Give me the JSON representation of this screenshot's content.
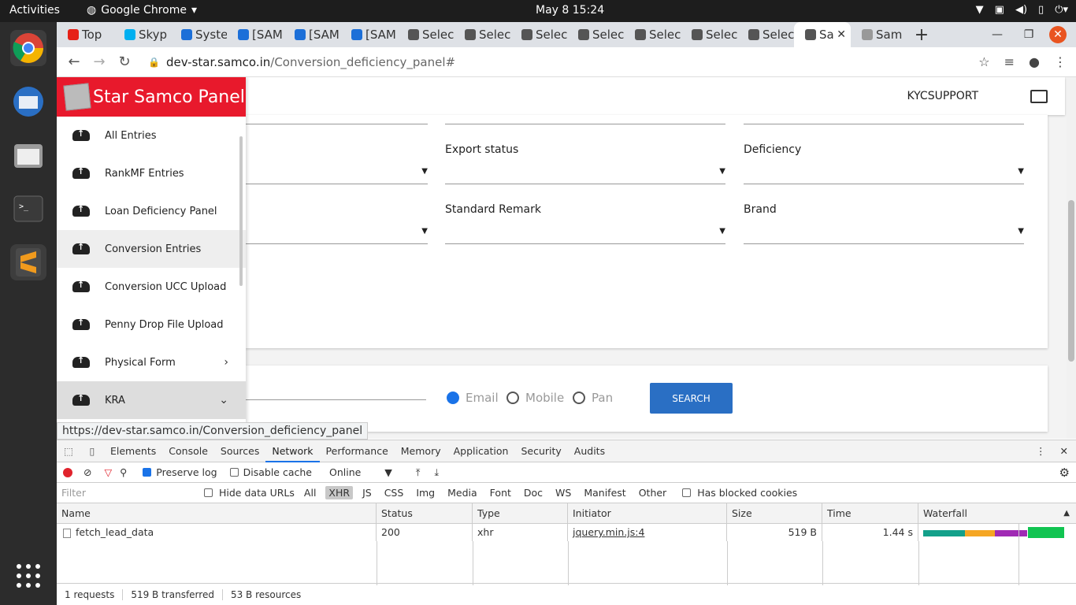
{
  "topbar": {
    "activities": "Activities",
    "app": "Google Chrome",
    "clock": "May 8  15:24"
  },
  "tabs": [
    {
      "label": "Top",
      "color": "#e62117"
    },
    {
      "label": "Skyp",
      "color": "#00aff0"
    },
    {
      "label": "Syste",
      "color": "#1c6fd8"
    },
    {
      "label": "[SAM",
      "color": "#1c6fd8"
    },
    {
      "label": "[SAM",
      "color": "#1c6fd8"
    },
    {
      "label": "[SAM",
      "color": "#1c6fd8"
    },
    {
      "label": "Selec",
      "color": "#555"
    },
    {
      "label": "Selec",
      "color": "#555"
    },
    {
      "label": "Selec",
      "color": "#555"
    },
    {
      "label": "Selec",
      "color": "#555"
    },
    {
      "label": "Selec",
      "color": "#555"
    },
    {
      "label": "Selec",
      "color": "#555"
    },
    {
      "label": "Selec",
      "color": "#555"
    },
    {
      "label": "Sa",
      "color": "#555"
    },
    {
      "label": "Sam",
      "color": "#999"
    }
  ],
  "omnibar": {
    "host": "dev-star.samco.in",
    "path": "/Conversion_deficiency_panel#"
  },
  "header": {
    "user": "KYCSUPPORT"
  },
  "brand": {
    "title": "Star Samco Panel"
  },
  "nav": [
    {
      "label": "All Entries"
    },
    {
      "label": "RankMF Entries"
    },
    {
      "label": "Loan Deficiency Panel"
    },
    {
      "label": "Conversion Entries"
    },
    {
      "label": "Conversion UCC Upload"
    },
    {
      "label": "Penny Drop File Upload"
    },
    {
      "label": "Physical Form",
      "chev": "›"
    },
    {
      "label": "KRA",
      "chev": "⌄"
    }
  ],
  "filters": {
    "export_status": "Export status",
    "deficiency": "Deficiency",
    "standard_remark": "Standard Remark",
    "brand": "Brand"
  },
  "search": {
    "opt_email": "Email",
    "opt_mobile": "Mobile",
    "opt_pan": "Pan",
    "button": "SEARCH"
  },
  "status_url": "https://dev-star.samco.in/Conversion_deficiency_panel",
  "devtools": {
    "tabs": [
      "Elements",
      "Console",
      "Sources",
      "Network",
      "Performance",
      "Memory",
      "Application",
      "Security",
      "Audits"
    ],
    "preserve_log": "Preserve log",
    "disable_cache": "Disable cache",
    "throttle": "Online",
    "filter_placeholder": "Filter",
    "hide_data_urls": "Hide data URLs",
    "types": [
      "All",
      "XHR",
      "JS",
      "CSS",
      "Img",
      "Media",
      "Font",
      "Doc",
      "WS",
      "Manifest",
      "Other"
    ],
    "blocked": "Has blocked cookies",
    "columns": [
      "Name",
      "Status",
      "Type",
      "Initiator",
      "Size",
      "Time",
      "Waterfall"
    ],
    "row": {
      "name": "fetch_lead_data",
      "status": "200",
      "type": "xhr",
      "initiator": "jquery.min.js:4",
      "size": "519 B",
      "time": "1.44 s"
    },
    "footer": [
      "1 requests",
      "519 B transferred",
      "53 B resources"
    ]
  }
}
